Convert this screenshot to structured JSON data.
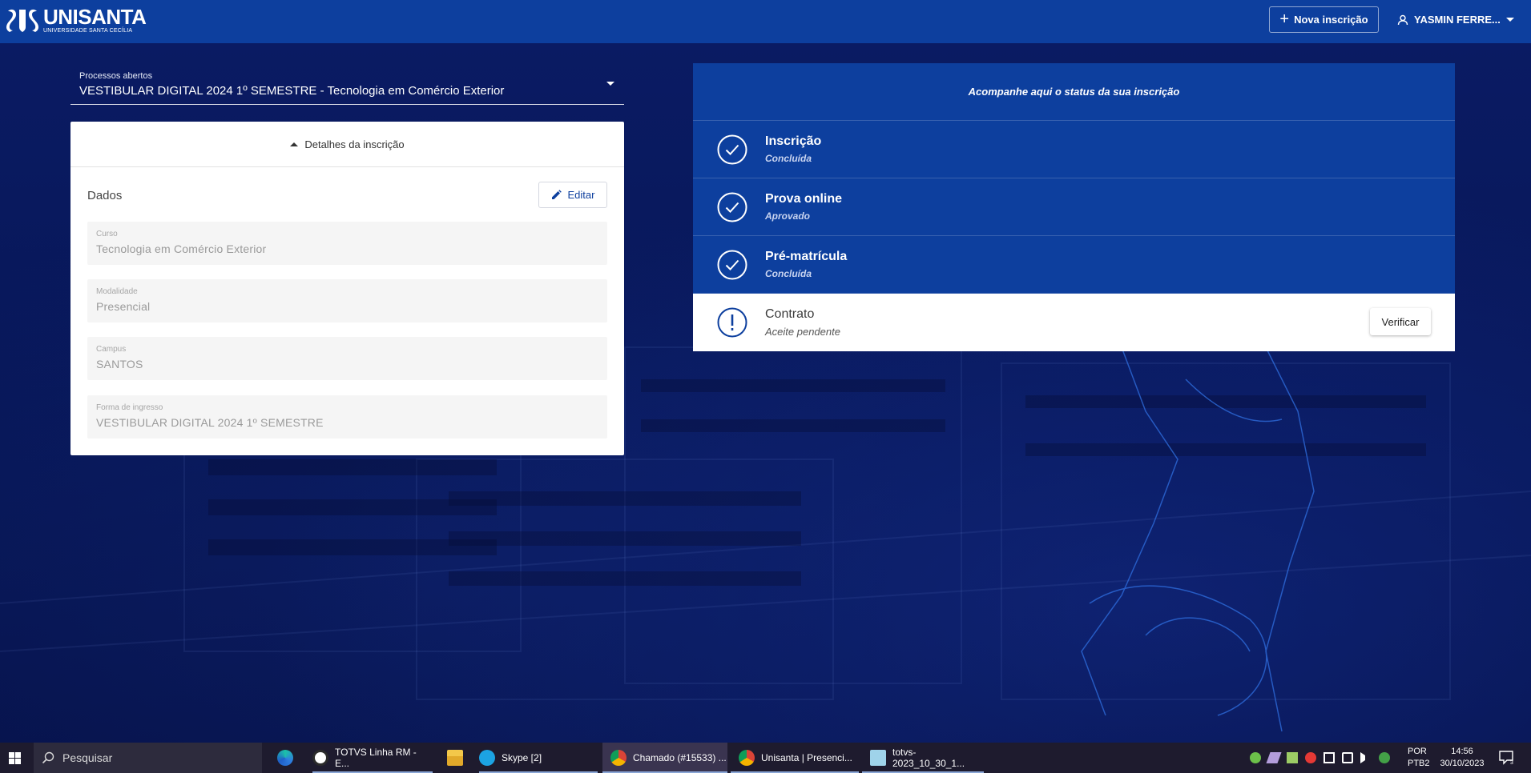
{
  "header": {
    "logo_name": "UNISANTA",
    "logo_sub": "UNIVERSIDADE SANTA CECÍLIA",
    "new_enrollment_label": "Nova inscrição",
    "user_name": "YASMIN FERRE..."
  },
  "process": {
    "label": "Processos abertos",
    "value": "VESTIBULAR DIGITAL 2024 1º SEMESTRE - Tecnologia em Comércio Exterior"
  },
  "details": {
    "toggle_label": "Detalhes da inscrição",
    "section_title": "Dados",
    "edit_label": "Editar",
    "fields": [
      {
        "label": "Curso",
        "value": "Tecnologia em Comércio Exterior"
      },
      {
        "label": "Modalidade",
        "value": "Presencial"
      },
      {
        "label": "Campus",
        "value": "SANTOS"
      },
      {
        "label": "Forma de ingresso",
        "value": "VESTIBULAR DIGITAL 2024 1º SEMESTRE"
      }
    ]
  },
  "status": {
    "header": "Acompanhe aqui o status da sua inscrição",
    "steps": [
      {
        "title": "Inscrição",
        "status": "Concluída",
        "icon": "check-circle-icon"
      },
      {
        "title": "Prova online",
        "status": "Aprovado",
        "icon": "check-circle-icon"
      },
      {
        "title": "Pré-matrícula",
        "status": "Concluída",
        "icon": "check-circle-icon"
      },
      {
        "title": "Contrato",
        "status": "Aceite pendente",
        "icon": "exclamation-circle-icon",
        "action": "Verificar"
      }
    ]
  },
  "taskbar": {
    "search_placeholder": "Pesquisar",
    "apps": [
      {
        "label": "",
        "icon": "edge-icon"
      },
      {
        "label": "TOTVS Linha RM - E...",
        "icon": "totvs-icon"
      },
      {
        "label": "",
        "icon": "file-explorer-icon"
      },
      {
        "label": "Skype [2]",
        "icon": "skype-icon",
        "badge": "2"
      },
      {
        "label": "Chamado (#15533) ...",
        "icon": "chrome-icon"
      },
      {
        "label": "Unisanta | Presenci...",
        "icon": "chrome-icon"
      },
      {
        "label": "totvs-2023_10_30_1...",
        "icon": "notepad-icon"
      }
    ],
    "language": "POR",
    "keyboard": "PTB2",
    "time": "14:56",
    "date": "30/10/2023",
    "notification_count": "3"
  },
  "colors": {
    "header_blue": "#0d3f9e",
    "background_navy": "#071659",
    "taskbar": "#1e1b2e"
  }
}
